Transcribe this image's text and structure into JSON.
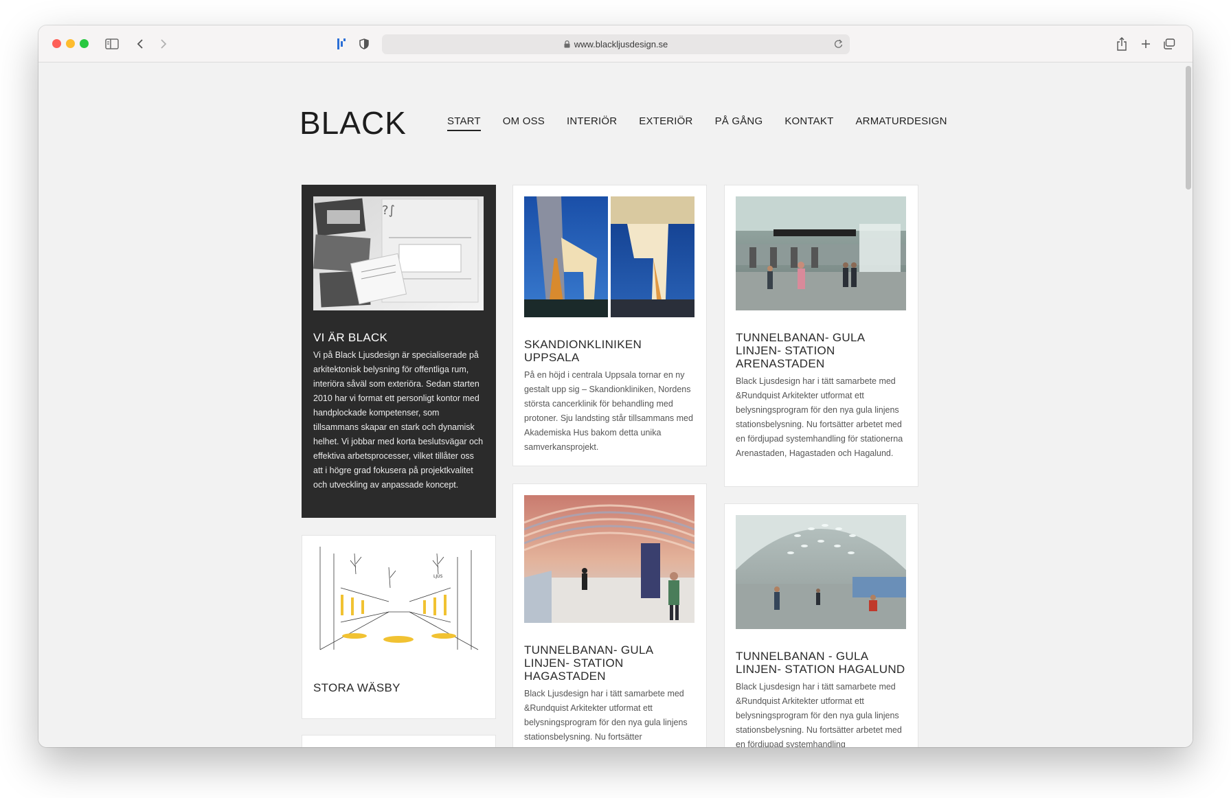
{
  "browser": {
    "url": "www.blackljusdesign.se"
  },
  "site": {
    "logo": "BLACK",
    "nav": [
      "START",
      "OM OSS",
      "INTERIÖR",
      "EXTERIÖR",
      "PÅ GÅNG",
      "KONTAKT",
      "ARMATURDESIGN"
    ],
    "active_nav": "START"
  },
  "cards": [
    {
      "title": "VI ÄR BLACK",
      "text": "Vi på Black Ljusdesign är specialiserade på arkitektonisk belysning för offentliga rum, interiöra såväl som exteriöra. Sedan starten 2010 har vi format ett personligt kontor med handplockade kompetenser, som tillsammans skapar en stark och dynamisk helhet. Vi jobbar med korta beslutsvägar och effektiva arbetsprocesser, vilket tillåter oss att i högre grad fokusera på projektkvalitet och utveckling av anpassade koncept."
    },
    {
      "title": "SKANDIONKLINIKEN UPPSALA",
      "text": "På en höjd i centrala Uppsala tornar en ny gestalt upp sig – Skandionkliniken, Nordens största cancerklinik för behandling med protoner. Sju landsting står tillsammans med Akademiska Hus bakom detta unika samverkansprojekt."
    },
    {
      "title": "TUNNELBANAN- GULA LINJEN- STATION ARENASTADEN",
      "text": "Black Ljusdesign har i tätt samarbete med &Rundquist Arkitekter utformat ett belysningsprogram för den nya gula linjens stationsbelysning. Nu fortsätter arbetet med en fördjupad systemhandling för stationerna Arenastaden, Hagastaden och Hagalund."
    },
    {
      "title": "STORA WÄSBY",
      "text": ""
    },
    {
      "title": "TUNNELBANAN- GULA LINJEN- STATION HAGASTADEN",
      "text": "Black Ljusdesign har i tätt samarbete med &Rundquist Arkitekter utformat ett belysningsprogram för den nya gula linjens stationsbelysning. Nu fortsätter"
    },
    {
      "title": "TUNNELBANAN - GULA LINJEN- STATION HAGALUND",
      "text": "Black Ljusdesign har i tätt samarbete med &Rundquist Arkitekter utformat ett belysningsprogram för den nya gula linjens stationsbelysning. Nu fortsätter arbetet med en fördjupad systemhandling"
    }
  ],
  "colors": {
    "dark_card": "#2b2b2b",
    "page_bg": "#f2f2f2",
    "text": "#222222"
  }
}
